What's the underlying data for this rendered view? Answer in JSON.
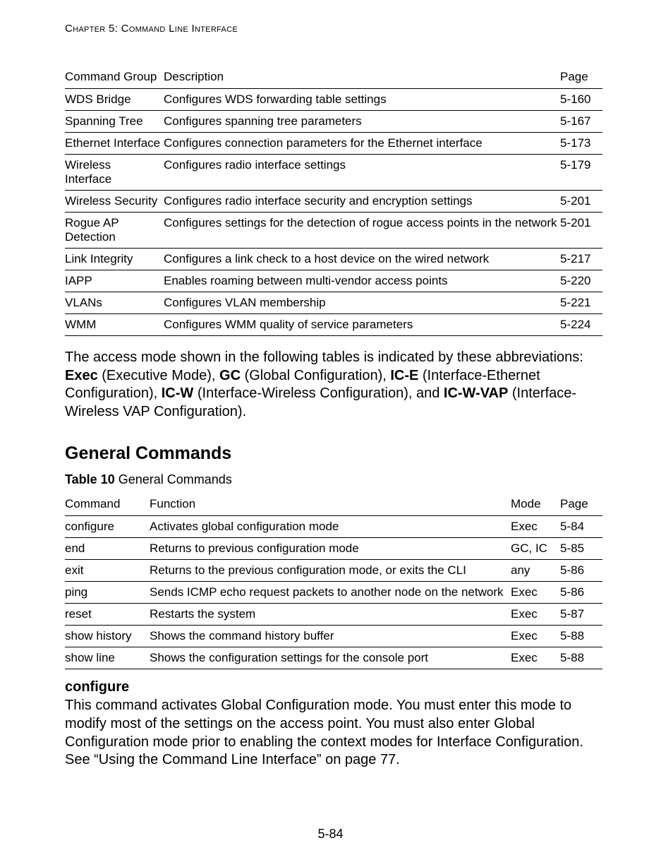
{
  "running_head": "Chapter 5: Command Line Interface",
  "table1": {
    "headers": {
      "group": "Command Group",
      "desc": "Description",
      "page": "Page"
    },
    "rows": [
      {
        "group": "WDS Bridge",
        "desc": "Configures WDS forwarding table settings",
        "page": "5-160"
      },
      {
        "group": "Spanning Tree",
        "desc": "Configures spanning tree parameters",
        "page": "5-167"
      },
      {
        "group": "Ethernet Interface",
        "desc": "Configures connection parameters for the Ethernet interface",
        "page": "5-173"
      },
      {
        "group": "Wireless Interface",
        "desc": "Configures radio interface settings",
        "page": "5-179"
      },
      {
        "group": "Wireless Security",
        "desc": "Configures radio interface security and encryption settings",
        "page": "5-201"
      },
      {
        "group": "Rogue AP Detection",
        "desc": "Configures settings for the detection of rogue access points in the network",
        "page": "5-201"
      },
      {
        "group": "Link Integrity",
        "desc": "Configures a link check to a host device on the wired network",
        "page": "5-217"
      },
      {
        "group": "IAPP",
        "desc": "Enables roaming between multi-vendor access points",
        "page": "5-220"
      },
      {
        "group": "VLANs",
        "desc": "Configures VLAN membership",
        "page": "5-221"
      },
      {
        "group": "WMM",
        "desc": "Configures WMM quality of service parameters",
        "page": "5-224"
      }
    ]
  },
  "para1": {
    "t1": "The access mode shown in the following tables is indicated by these abbreviations: ",
    "b1": "Exec",
    "t2": " (Executive Mode), ",
    "b2": "GC",
    "t3": " (Global Configuration), ",
    "b3": "IC-E",
    "t4": " (Interface-Ethernet Configuration), ",
    "b4": "IC-W",
    "t5": " (Interface-Wireless Configuration), and ",
    "b5": "IC-W-VAP",
    "t6": " (Interface-Wireless VAP Configuration)."
  },
  "section_heading": "General Commands",
  "table2_caption": {
    "label": "Table 10",
    "title": "   General Commands"
  },
  "table2": {
    "headers": {
      "cmd": "Command",
      "func": "Function",
      "mode": "Mode",
      "page": "Page"
    },
    "rows": [
      {
        "cmd": "configure",
        "func": "Activates global configuration mode",
        "mode": "Exec",
        "page": "5-84"
      },
      {
        "cmd": "end",
        "func": "Returns to previous configuration mode",
        "mode": "GC, IC",
        "page": "5-85"
      },
      {
        "cmd": "exit",
        "func": "Returns to the previous configuration mode, or exits the CLI",
        "mode": "any",
        "page": "5-86"
      },
      {
        "cmd": "ping",
        "func": "Sends ICMP echo request packets to another node on the network",
        "mode": "Exec",
        "page": "5-86"
      },
      {
        "cmd": "reset",
        "func": "Restarts the system",
        "mode": "Exec",
        "page": "5-87"
      },
      {
        "cmd": "show history",
        "func": "Shows the command history buffer",
        "mode": "Exec",
        "page": "5-88"
      },
      {
        "cmd": "show line",
        "func": "Shows the configuration settings for the console port",
        "mode": "Exec",
        "page": "5-88"
      }
    ]
  },
  "subhead": "configure",
  "para2": "This command activates Global Configuration mode. You must enter this mode to modify most of the settings on the access point. You must also enter Global Configuration mode prior to enabling the context modes for Interface Configuration. See “Using the Command Line Interface” on page 77.",
  "footer_page": "5-84"
}
